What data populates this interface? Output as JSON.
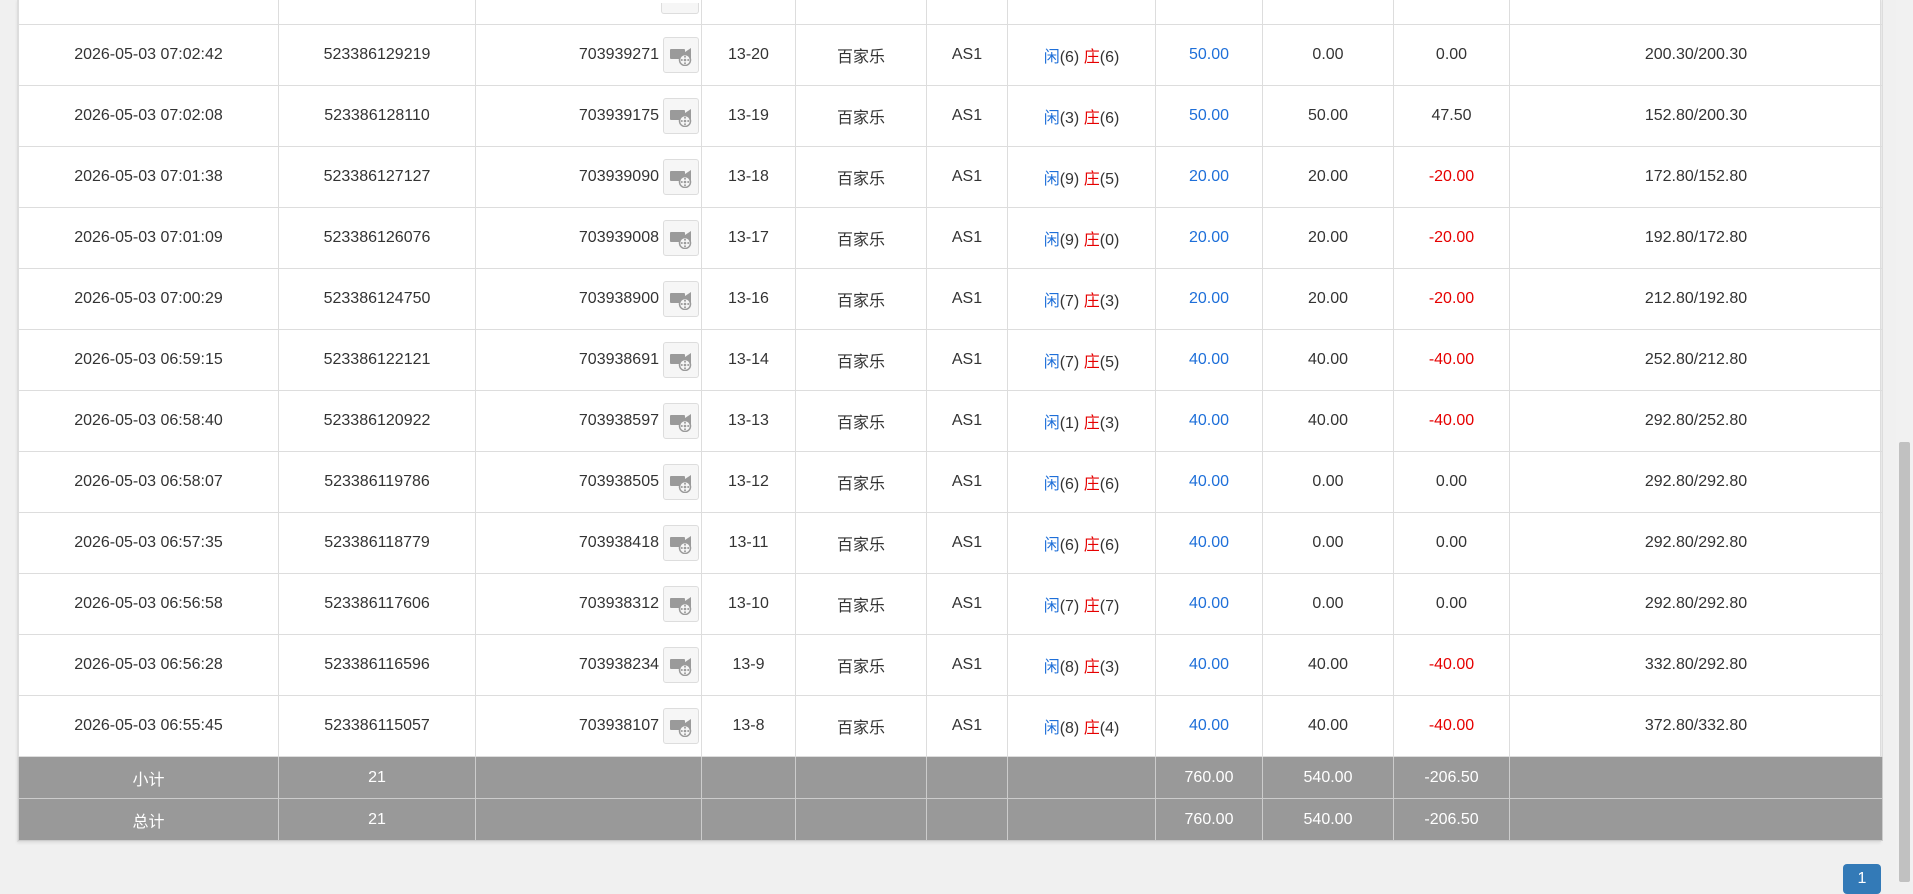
{
  "rows": [
    {
      "time": "2026-05-03 07:02:42",
      "bet_no": "523386129219",
      "round_no": "703939271",
      "shoe": "13-20",
      "game": "百家乐",
      "table": "AS1",
      "player_label": "闲",
      "player_pts": "(6)",
      "banker_label": "庄",
      "banker_pts": "(6)",
      "bet": "50.00",
      "valid": "0.00",
      "win": "0.00",
      "win_neg": false,
      "balance": "200.30/200.30"
    },
    {
      "time": "2026-05-03 07:02:08",
      "bet_no": "523386128110",
      "round_no": "703939175",
      "shoe": "13-19",
      "game": "百家乐",
      "table": "AS1",
      "player_label": "闲",
      "player_pts": "(3)",
      "banker_label": "庄",
      "banker_pts": "(6)",
      "bet": "50.00",
      "valid": "50.00",
      "win": "47.50",
      "win_neg": false,
      "balance": "152.80/200.30"
    },
    {
      "time": "2026-05-03 07:01:38",
      "bet_no": "523386127127",
      "round_no": "703939090",
      "shoe": "13-18",
      "game": "百家乐",
      "table": "AS1",
      "player_label": "闲",
      "player_pts": "(9)",
      "banker_label": "庄",
      "banker_pts": "(5)",
      "bet": "20.00",
      "valid": "20.00",
      "win": "-20.00",
      "win_neg": true,
      "balance": "172.80/152.80"
    },
    {
      "time": "2026-05-03 07:01:09",
      "bet_no": "523386126076",
      "round_no": "703939008",
      "shoe": "13-17",
      "game": "百家乐",
      "table": "AS1",
      "player_label": "闲",
      "player_pts": "(9)",
      "banker_label": "庄",
      "banker_pts": "(0)",
      "bet": "20.00",
      "valid": "20.00",
      "win": "-20.00",
      "win_neg": true,
      "balance": "192.80/172.80"
    },
    {
      "time": "2026-05-03 07:00:29",
      "bet_no": "523386124750",
      "round_no": "703938900",
      "shoe": "13-16",
      "game": "百家乐",
      "table": "AS1",
      "player_label": "闲",
      "player_pts": "(7)",
      "banker_label": "庄",
      "banker_pts": "(3)",
      "bet": "20.00",
      "valid": "20.00",
      "win": "-20.00",
      "win_neg": true,
      "balance": "212.80/192.80"
    },
    {
      "time": "2026-05-03 06:59:15",
      "bet_no": "523386122121",
      "round_no": "703938691",
      "shoe": "13-14",
      "game": "百家乐",
      "table": "AS1",
      "player_label": "闲",
      "player_pts": "(7)",
      "banker_label": "庄",
      "banker_pts": "(5)",
      "bet": "40.00",
      "valid": "40.00",
      "win": "-40.00",
      "win_neg": true,
      "balance": "252.80/212.80"
    },
    {
      "time": "2026-05-03 06:58:40",
      "bet_no": "523386120922",
      "round_no": "703938597",
      "shoe": "13-13",
      "game": "百家乐",
      "table": "AS1",
      "player_label": "闲",
      "player_pts": "(1)",
      "banker_label": "庄",
      "banker_pts": "(3)",
      "bet": "40.00",
      "valid": "40.00",
      "win": "-40.00",
      "win_neg": true,
      "balance": "292.80/252.80"
    },
    {
      "time": "2026-05-03 06:58:07",
      "bet_no": "523386119786",
      "round_no": "703938505",
      "shoe": "13-12",
      "game": "百家乐",
      "table": "AS1",
      "player_label": "闲",
      "player_pts": "(6)",
      "banker_label": "庄",
      "banker_pts": "(6)",
      "bet": "40.00",
      "valid": "0.00",
      "win": "0.00",
      "win_neg": false,
      "balance": "292.80/292.80"
    },
    {
      "time": "2026-05-03 06:57:35",
      "bet_no": "523386118779",
      "round_no": "703938418",
      "shoe": "13-11",
      "game": "百家乐",
      "table": "AS1",
      "player_label": "闲",
      "player_pts": "(6)",
      "banker_label": "庄",
      "banker_pts": "(6)",
      "bet": "40.00",
      "valid": "0.00",
      "win": "0.00",
      "win_neg": false,
      "balance": "292.80/292.80"
    },
    {
      "time": "2026-05-03 06:56:58",
      "bet_no": "523386117606",
      "round_no": "703938312",
      "shoe": "13-10",
      "game": "百家乐",
      "table": "AS1",
      "player_label": "闲",
      "player_pts": "(7)",
      "banker_label": "庄",
      "banker_pts": "(7)",
      "bet": "40.00",
      "valid": "0.00",
      "win": "0.00",
      "win_neg": false,
      "balance": "292.80/292.80"
    },
    {
      "time": "2026-05-03 06:56:28",
      "bet_no": "523386116596",
      "round_no": "703938234",
      "shoe": "13-9",
      "game": "百家乐",
      "table": "AS1",
      "player_label": "闲",
      "player_pts": "(8)",
      "banker_label": "庄",
      "banker_pts": "(3)",
      "bet": "40.00",
      "valid": "40.00",
      "win": "-40.00",
      "win_neg": true,
      "balance": "332.80/292.80"
    },
    {
      "time": "2026-05-03 06:55:45",
      "bet_no": "523386115057",
      "round_no": "703938107",
      "shoe": "13-8",
      "game": "百家乐",
      "table": "AS1",
      "player_label": "闲",
      "player_pts": "(8)",
      "banker_label": "庄",
      "banker_pts": "(4)",
      "bet": "40.00",
      "valid": "40.00",
      "win": "-40.00",
      "win_neg": true,
      "balance": "372.80/332.80"
    }
  ],
  "subtotal": {
    "label": "小计",
    "count": "21",
    "bet": "760.00",
    "valid": "540.00",
    "win": "-206.50"
  },
  "total": {
    "label": "总计",
    "count": "21",
    "bet": "760.00",
    "valid": "540.00",
    "win": "-206.50"
  },
  "pagination": {
    "current_page": "1"
  },
  "colors": {
    "player": "#1e6fd9",
    "banker": "#e60000",
    "negative": "#e60000",
    "summary_bg": "#999999",
    "pager": "#337ab7"
  },
  "icons": {
    "round_video": "video-replay-icon"
  }
}
